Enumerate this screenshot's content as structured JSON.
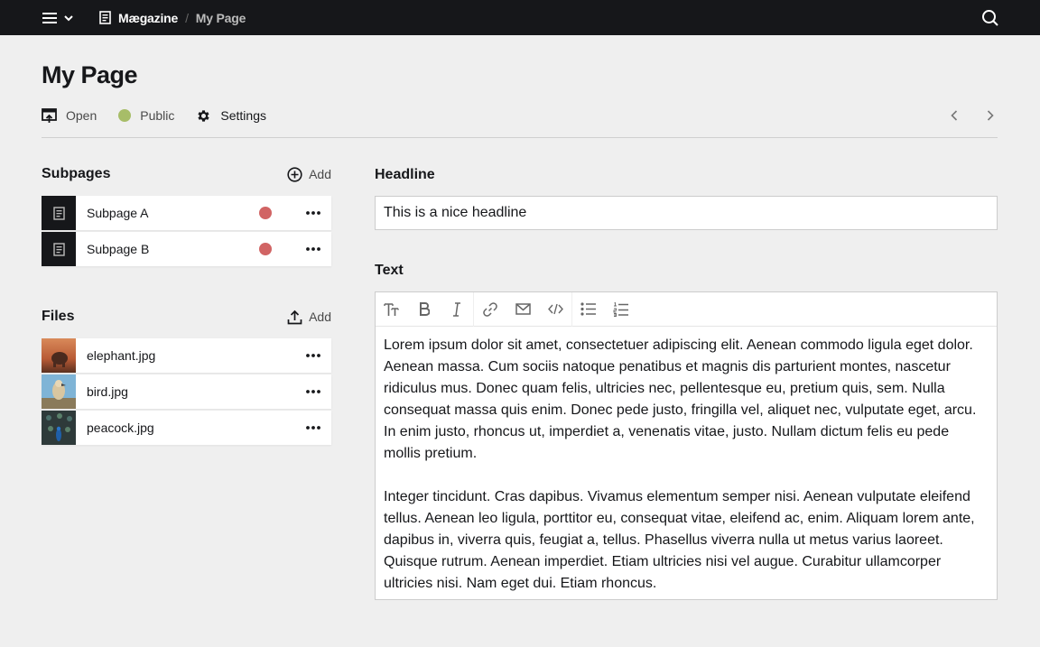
{
  "topbar": {
    "site_name": "Mægazine",
    "separator": "/",
    "current_page": "My Page"
  },
  "page": {
    "title": "My Page",
    "tabs": [
      {
        "label": "Open",
        "icon": "open-preview-icon"
      },
      {
        "label": "Public",
        "icon": "status-dot",
        "color": "#a7bd68"
      },
      {
        "label": "Settings",
        "icon": "gear-icon"
      }
    ]
  },
  "subpages": {
    "title": "Subpages",
    "add_label": "Add",
    "items": [
      {
        "label": "Subpage A",
        "status_color": "#d16464"
      },
      {
        "label": "Subpage B",
        "status_color": "#d16464"
      }
    ]
  },
  "files": {
    "title": "Files",
    "add_label": "Add",
    "items": [
      {
        "label": "elephant.jpg"
      },
      {
        "label": "bird.jpg"
      },
      {
        "label": "peacock.jpg"
      }
    ]
  },
  "fields": {
    "headline": {
      "label": "Headline",
      "value": "This is a nice headline"
    },
    "text": {
      "label": "Text",
      "toolbar": [
        "headings-icon",
        "bold-icon",
        "italic-icon",
        "link-icon",
        "email-icon",
        "code-icon",
        "bullet-list-icon",
        "ordered-list-icon"
      ],
      "paragraphs": [
        "Lorem ipsum dolor sit amet, consectetuer adipiscing elit. Aenean commodo ligula eget dolor. Aenean massa. Cum sociis natoque penatibus et magnis dis parturient montes, nascetur ridiculus mus. Donec quam felis, ultricies nec, pellentesque eu, pretium quis, sem. Nulla consequat massa quis enim. Donec pede justo, fringilla vel, aliquet nec, vulputate eget, arcu. In enim justo, rhoncus ut, imperdiet a, venenatis vitae, justo. Nullam dictum felis eu pede mollis pretium.",
        "Integer tincidunt. Cras dapibus. Vivamus elementum semper nisi. Aenean vulputate eleifend tellus. Aenean leo ligula, porttitor eu, consequat vitae, eleifend ac, enim. Aliquam lorem ante, dapibus in, viverra quis, feugiat a, tellus. Phasellus viverra nulla ut metus varius laoreet. Quisque rutrum. Aenean imperdiet. Etiam ultricies nisi vel augue. Curabitur ullamcorper ultricies nisi. Nam eget dui. Etiam rhoncus."
      ]
    }
  },
  "colors": {
    "topbar": "#16171a",
    "background": "#efefef",
    "status_public": "#a7bd68",
    "status_draft": "#d16464"
  }
}
